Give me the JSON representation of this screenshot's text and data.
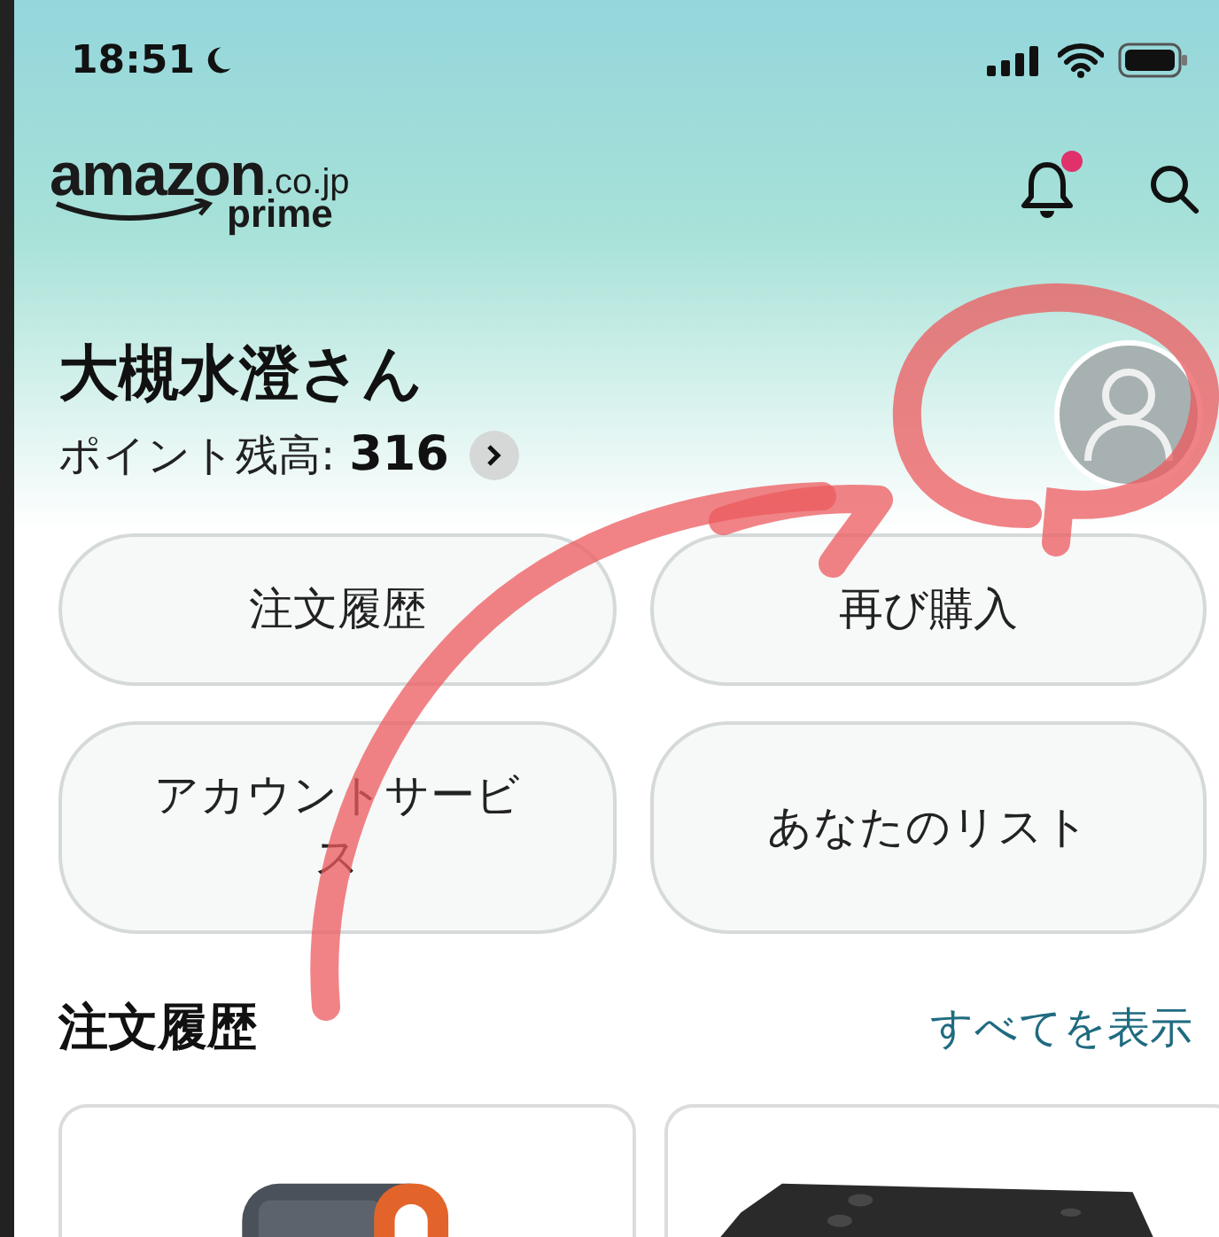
{
  "status_bar": {
    "time": "18:51"
  },
  "header": {
    "logo": {
      "wordmark": "amazon",
      "domain": ".co.jp",
      "tier": "prime"
    },
    "notification_badge": true
  },
  "profile": {
    "greeting": "大槻水澄さん",
    "points_label": "ポイント残高:",
    "points_value": "316"
  },
  "quick_buttons": [
    "注文履歴",
    "再び購入",
    "アカウントサービス",
    "あなたのリスト"
  ],
  "order_history": {
    "title": "注文履歴",
    "see_all": "すべてを表示"
  }
}
